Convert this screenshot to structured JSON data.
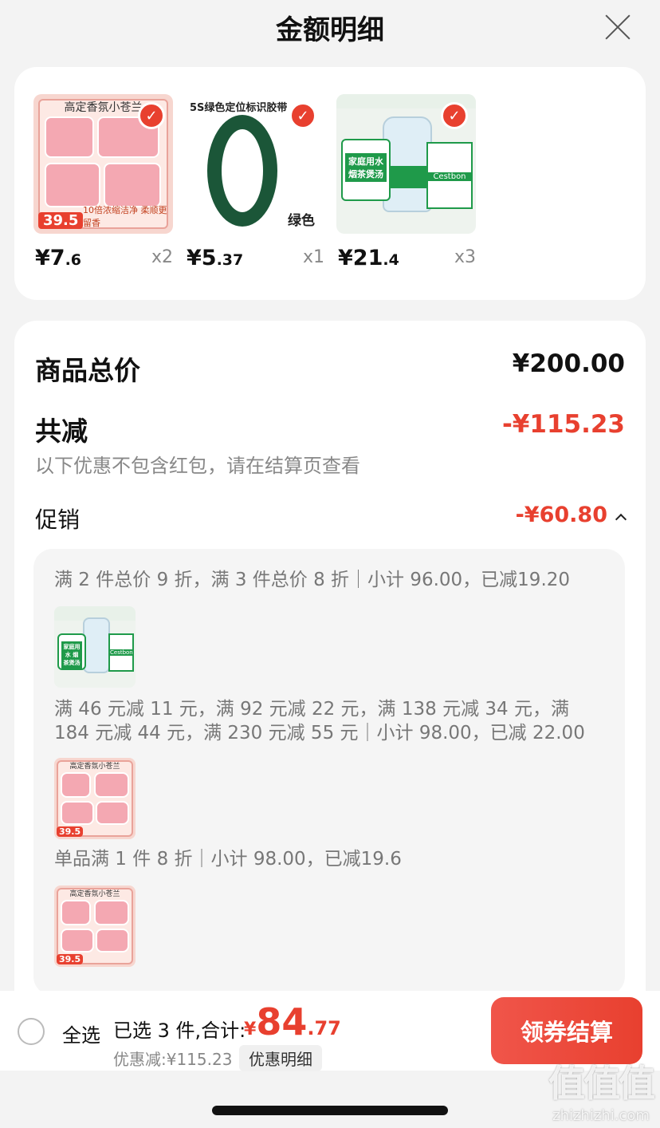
{
  "header": {
    "title": "金额明细"
  },
  "products": [
    {
      "price_int": "¥7",
      "price_dec": ".6",
      "qty": "x2",
      "thumb": {
        "band": "高定香氛小苍兰",
        "tag": "39.5",
        "foot": "10倍浓缩洁净 柔顺更留香"
      }
    },
    {
      "price_int": "¥5",
      "price_dec": ".37",
      "qty": "x1",
      "thumb": {
        "label": "5S绿色定位标识胶带",
        "color": "绿色"
      }
    },
    {
      "price_int": "¥21",
      "price_dec": ".4",
      "qty": "x3",
      "thumb": {
        "sign": "家庭用水 烟茶煲汤",
        "crate": "Cestbon"
      }
    }
  ],
  "summary": {
    "total_label": "商品总价",
    "total_value": "¥200.00",
    "reduce_label": "共减",
    "reduce_value": "-¥115.23",
    "note": "以下优惠不包含红包，请在结算页查看",
    "promo_label": "促销",
    "promo_value": "-¥60.80",
    "promos": [
      {
        "text": "满 2 件总价 9 折，满 3 件总价 8 折｜小计 96.00，已减19.20"
      },
      {
        "text": "满 46 元减 11 元，满 92 元减 22 元，满 138 元减 34 元，满 184 元减 44 元，满 230 元减 55 元｜小计 98.00，已减 22.00"
      },
      {
        "text": "单品满 1 件 8 折｜小计 98.00，已减19.6"
      }
    ]
  },
  "bottom_bar": {
    "select_all": "全选",
    "selected_info": "已选 3 件,合计:",
    "total_yen": "¥",
    "total_int": "84",
    "total_dec": ".77",
    "discount": "优惠减:¥115.23",
    "discount_detail": "优惠明细",
    "checkout": "领券结算"
  },
  "watermark": {
    "big": "值值值",
    "small": "zhizhizhi.com"
  },
  "colors": {
    "accent": "#e8402f",
    "background": "#f3f3f3"
  }
}
